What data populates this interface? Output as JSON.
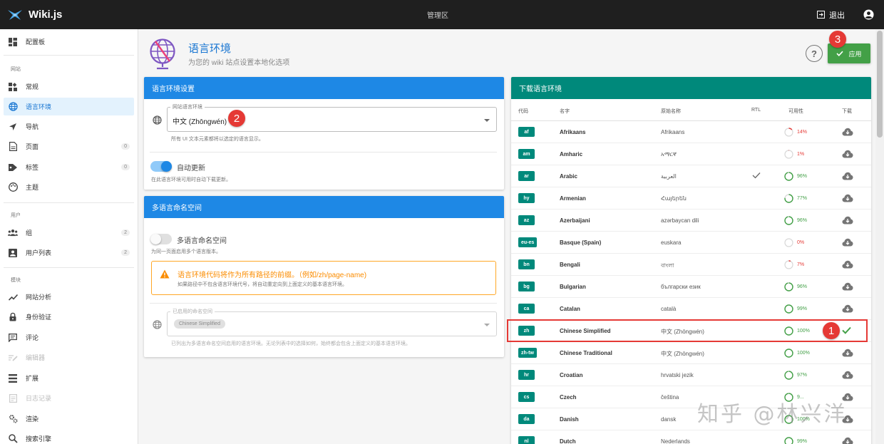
{
  "app": {
    "name": "Wiki.js",
    "area": "管理区",
    "logout": "退出"
  },
  "sidebar": {
    "dashboard": "配置板",
    "sections": {
      "site": "网站",
      "users": "用户",
      "modules": "模块"
    },
    "items": {
      "general": "常规",
      "locale": "语言环境",
      "navigation": "导航",
      "pages": "页面",
      "pages_count": "0",
      "tags": "标签",
      "tags_count": "0",
      "theme": "主题",
      "groups": "组",
      "groups_count": "2",
      "user_list": "用户列表",
      "users_count": "2",
      "analytics": "网站分析",
      "auth": "身份验证",
      "comments": "评论",
      "editors": "编辑器",
      "extensions": "扩展",
      "logging": "日志记录",
      "rendering": "渲染",
      "search": "搜索引擎"
    }
  },
  "header": {
    "title": "语言环境",
    "subtitle": "为您的 wiki 站点设置本地化选项",
    "apply": "应用",
    "help": "?"
  },
  "markers": {
    "one": "1",
    "two": "2",
    "three": "3"
  },
  "locale_settings": {
    "title": "语言环境设置",
    "field_label": "网站语言环境",
    "field_value": "中文 (Zhōngwén)",
    "field_hint": "所有 UI 文本元素都将以选定的语言显示。",
    "auto_update_label": "自动更新",
    "auto_update_hint": "在此语言环境可用时自动下载更新。"
  },
  "namespaces": {
    "title": "多语言命名空间",
    "toggle_label": "多语言命名空间",
    "toggle_hint": "为同一页面启用多个语言版本。",
    "alert_title": "语言环境代码将作为所有路径的前缀。（例如/zh/page-name)",
    "alert_text": "如果路径中不包含语言环境代号，将自动重定向到上面定义的基本语言环境。",
    "active_label": "已启用的命名空间",
    "active_chip": "Chinese Simplified",
    "active_hint": "已列出为多语言命名空间启用的语言环境。无论列表中的选择如何，始终都会包含上面定义的基本语言环境。"
  },
  "download": {
    "title": "下载语言环境",
    "columns": {
      "code": "代码",
      "name": "名字",
      "native": "原始名称",
      "rtl": "RTL",
      "availability": "可用性",
      "download": "下载"
    },
    "rows": [
      {
        "code": "af",
        "name": "Afrikaans",
        "native": "Afrikaans",
        "rtl": false,
        "availability": "14%",
        "avail_pct": 14,
        "installed": false
      },
      {
        "code": "am",
        "name": "Amharic",
        "native": "አማርኛ",
        "rtl": false,
        "availability": "1%",
        "avail_pct": 1,
        "installed": false
      },
      {
        "code": "ar",
        "name": "Arabic",
        "native": "العربية",
        "rtl": true,
        "availability": "96%",
        "avail_pct": 96,
        "installed": false
      },
      {
        "code": "hy",
        "name": "Armenian",
        "native": "Հայերեն",
        "rtl": false,
        "availability": "77%",
        "avail_pct": 77,
        "installed": false
      },
      {
        "code": "az",
        "name": "Azerbaijani",
        "native": "azərbaycan dili",
        "rtl": false,
        "availability": "96%",
        "avail_pct": 96,
        "installed": false
      },
      {
        "code": "eu-es",
        "name": "Basque (Spain)",
        "native": "euskara",
        "rtl": false,
        "availability": "0%",
        "avail_pct": 0,
        "installed": false
      },
      {
        "code": "bn",
        "name": "Bengali",
        "native": "বাংলা",
        "rtl": false,
        "availability": "7%",
        "avail_pct": 7,
        "installed": false
      },
      {
        "code": "bg",
        "name": "Bulgarian",
        "native": "български език",
        "rtl": false,
        "availability": "96%",
        "avail_pct": 96,
        "installed": false
      },
      {
        "code": "ca",
        "name": "Catalan",
        "native": "català",
        "rtl": false,
        "availability": "99%",
        "avail_pct": 99,
        "installed": false
      },
      {
        "code": "zh",
        "name": "Chinese Simplified",
        "native": "中文 (Zhōngwén)",
        "rtl": false,
        "availability": "100%",
        "avail_pct": 100,
        "installed": true
      },
      {
        "code": "zh-tw",
        "name": "Chinese Traditional",
        "native": "中文 (Zhōngwén)",
        "rtl": false,
        "availability": "100%",
        "avail_pct": 100,
        "installed": false
      },
      {
        "code": "hr",
        "name": "Croatian",
        "native": "hrvatski jezik",
        "rtl": false,
        "availability": "97%",
        "avail_pct": 97,
        "installed": false
      },
      {
        "code": "cs",
        "name": "Czech",
        "native": "čeština",
        "rtl": false,
        "availability": "9...",
        "avail_pct": 98,
        "installed": false
      },
      {
        "code": "da",
        "name": "Danish",
        "native": "dansk",
        "rtl": false,
        "availability": "100%",
        "avail_pct": 100,
        "installed": false
      },
      {
        "code": "nl",
        "name": "Dutch",
        "native": "Nederlands",
        "rtl": false,
        "availability": "99%",
        "avail_pct": 99,
        "installed": false
      }
    ]
  },
  "watermark": "知乎 @林兴洋",
  "colors": {
    "primary": "#1e88e5",
    "teal": "#00897b",
    "success": "#43a047",
    "warning": "#fb8c00",
    "marker": "#e53935"
  }
}
